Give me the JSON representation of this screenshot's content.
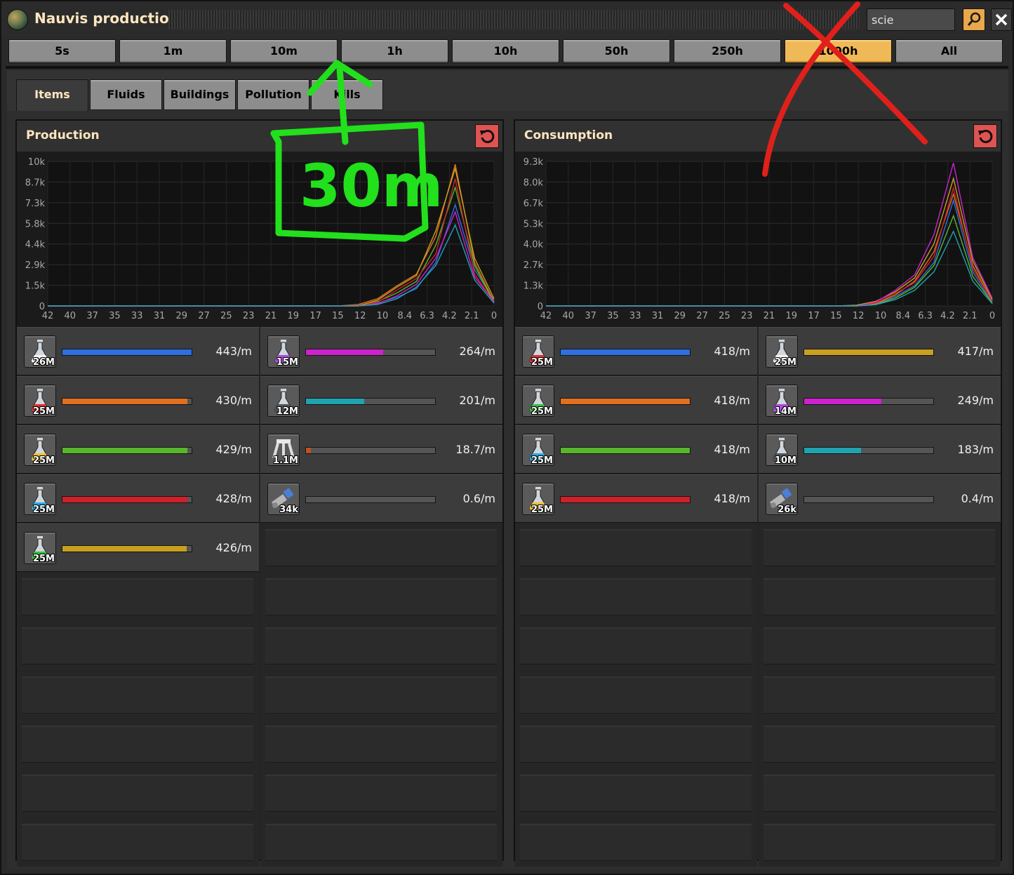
{
  "window": {
    "title": "Nauvis production"
  },
  "search": {
    "value": "scie"
  },
  "time_ranges": [
    {
      "label": "5s",
      "active": false
    },
    {
      "label": "1m",
      "active": false
    },
    {
      "label": "10m",
      "active": false
    },
    {
      "label": "1h",
      "active": false
    },
    {
      "label": "10h",
      "active": false
    },
    {
      "label": "50h",
      "active": false
    },
    {
      "label": "250h",
      "active": false
    },
    {
      "label": "1000h",
      "active": true
    },
    {
      "label": "All",
      "active": false
    }
  ],
  "tabs": [
    {
      "label": "Items",
      "active": true
    },
    {
      "label": "Fluids",
      "active": false
    },
    {
      "label": "Buildings",
      "active": false
    },
    {
      "label": "Pollution",
      "active": false
    },
    {
      "label": "Kills",
      "active": false
    }
  ],
  "colors": {
    "accent": "#f0b957",
    "reset": "#e05353",
    "annotation_green": "#22e01b",
    "annotation_red": "#e0201b"
  },
  "annotations": {
    "handwritten_text": "30m"
  },
  "production": {
    "title": "Production",
    "chart_data": {
      "type": "line",
      "ylabel_ticks": [
        "10k",
        "8.7k",
        "7.3k",
        "5.8k",
        "4.4k",
        "2.9k",
        "1.5k",
        "0"
      ],
      "x_ticks": [
        "42",
        "40",
        "37",
        "35",
        "33",
        "31",
        "29",
        "27",
        "25",
        "23",
        "21",
        "19",
        "17",
        "15",
        "12",
        "10",
        "8.4",
        "6.3",
        "4.2",
        "2.1",
        "0"
      ],
      "ylim": [
        0,
        10000
      ],
      "grid": true,
      "series": [
        {
          "color": "#2f6fe0",
          "values": [
            0,
            0,
            0,
            0,
            0,
            0,
            0,
            0,
            0,
            0,
            0,
            0,
            0,
            0,
            0,
            0,
            0,
            200,
            600,
            1200,
            3000,
            7000,
            2500,
            400
          ]
        },
        {
          "color": "#e07020",
          "values": [
            0,
            0,
            0,
            0,
            0,
            0,
            0,
            0,
            0,
            0,
            0,
            0,
            0,
            0,
            0,
            0,
            100,
            500,
            1400,
            2200,
            4800,
            9800,
            3000,
            300
          ]
        },
        {
          "color": "#58b62c",
          "values": [
            0,
            0,
            0,
            0,
            0,
            0,
            0,
            0,
            0,
            0,
            0,
            0,
            0,
            0,
            0,
            0,
            0,
            300,
            900,
            1700,
            4200,
            8200,
            2800,
            200
          ]
        },
        {
          "color": "#d0202a",
          "values": [
            0,
            0,
            0,
            0,
            0,
            0,
            0,
            0,
            0,
            0,
            0,
            0,
            0,
            0,
            0,
            0,
            50,
            250,
            1100,
            1900,
            3600,
            8800,
            2200,
            250
          ]
        },
        {
          "color": "#c8a020",
          "values": [
            0,
            0,
            0,
            0,
            0,
            0,
            0,
            0,
            0,
            0,
            0,
            0,
            0,
            0,
            0,
            0,
            0,
            400,
            1300,
            2100,
            5200,
            9500,
            3300,
            500
          ]
        },
        {
          "color": "#cc22cc",
          "values": [
            0,
            0,
            0,
            0,
            0,
            0,
            0,
            0,
            0,
            0,
            0,
            0,
            0,
            0,
            0,
            0,
            0,
            150,
            700,
            1500,
            3300,
            6500,
            2000,
            300
          ]
        },
        {
          "color": "#1fa3b0",
          "values": [
            0,
            0,
            0,
            0,
            0,
            0,
            0,
            0,
            0,
            0,
            0,
            0,
            0,
            0,
            0,
            0,
            0,
            100,
            500,
            1300,
            2800,
            5600,
            1800,
            200
          ]
        }
      ]
    },
    "rows": [
      {
        "icon": "white-science-pack-icon",
        "flask": "#f4f4f4",
        "count": "26M",
        "bar_color": "#2f6fe0",
        "fill": 1.0,
        "rate": "443/m"
      },
      {
        "icon": "purple-science-pack-icon",
        "flask": "#b04ae0",
        "count": "15M",
        "bar_color": "#cc22cc",
        "fill": 0.6,
        "rate": "264/m"
      },
      {
        "icon": "red-science-pack-icon",
        "flask": "#e03030",
        "count": "25M",
        "bar_color": "#e07020",
        "fill": 0.97,
        "rate": "430/m"
      },
      {
        "icon": "black-science-pack-icon",
        "flask": "#555555",
        "count": "12M",
        "bar_color": "#1fa3b0",
        "fill": 0.45,
        "rate": "201/m"
      },
      {
        "icon": "yellow-science-pack-icon",
        "flask": "#f0c030",
        "count": "25M",
        "bar_color": "#58b62c",
        "fill": 0.97,
        "rate": "429/m"
      },
      {
        "icon": "lab-icon",
        "flask": "#bbbbbb",
        "count": "1.1M",
        "bar_color": "#c05020",
        "fill": 0.04,
        "rate": "18.7/m"
      },
      {
        "icon": "blue-science-pack-icon",
        "flask": "#2aa8e0",
        "count": "25M",
        "bar_color": "#d0202a",
        "fill": 0.97,
        "rate": "428/m"
      },
      {
        "icon": "satellite-icon",
        "flask": "#9aa0a8",
        "count": "34k",
        "bar_color": "#666666",
        "fill": 0.0,
        "rate": "0.6/m"
      },
      {
        "icon": "green-science-pack-icon",
        "flask": "#38c040",
        "count": "25M",
        "bar_color": "#c8a020",
        "fill": 0.96,
        "rate": "426/m"
      }
    ]
  },
  "consumption": {
    "title": "Consumption",
    "chart_data": {
      "type": "line",
      "ylabel_ticks": [
        "9.3k",
        "8.0k",
        "6.7k",
        "5.3k",
        "4.0k",
        "2.7k",
        "1.3k",
        "0"
      ],
      "x_ticks": [
        "42",
        "40",
        "37",
        "35",
        "33",
        "31",
        "29",
        "27",
        "25",
        "23",
        "21",
        "19",
        "17",
        "15",
        "12",
        "10",
        "8.4",
        "6.3",
        "4.2",
        "2.1",
        "0"
      ],
      "ylim": [
        0,
        9300
      ],
      "grid": true,
      "series": [
        {
          "color": "#2f6fe0",
          "values": [
            0,
            0,
            0,
            0,
            0,
            0,
            0,
            0,
            0,
            0,
            0,
            0,
            0,
            0,
            0,
            0,
            0,
            100,
            600,
            1300,
            2800,
            6800,
            2200,
            200
          ]
        },
        {
          "color": "#e07020",
          "values": [
            0,
            0,
            0,
            0,
            0,
            0,
            0,
            0,
            0,
            0,
            0,
            0,
            0,
            0,
            0,
            0,
            0,
            150,
            700,
            1600,
            3500,
            7200,
            2600,
            300
          ]
        },
        {
          "color": "#58b62c",
          "values": [
            0,
            0,
            0,
            0,
            0,
            0,
            0,
            0,
            0,
            0,
            0,
            0,
            0,
            0,
            0,
            0,
            0,
            100,
            500,
            1200,
            2600,
            5800,
            1900,
            200
          ]
        },
        {
          "color": "#d0202a",
          "values": [
            0,
            0,
            0,
            0,
            0,
            0,
            0,
            0,
            0,
            0,
            0,
            0,
            0,
            0,
            0,
            0,
            0,
            200,
            800,
            1500,
            3200,
            7600,
            2400,
            300
          ]
        },
        {
          "color": "#c8a020",
          "values": [
            0,
            0,
            0,
            0,
            0,
            0,
            0,
            0,
            0,
            0,
            0,
            0,
            0,
            0,
            0,
            0,
            50,
            300,
            900,
            1800,
            4000,
            8200,
            2900,
            400
          ]
        },
        {
          "color": "#cc22cc",
          "values": [
            0,
            0,
            0,
            0,
            0,
            0,
            0,
            0,
            0,
            0,
            0,
            0,
            0,
            0,
            0,
            0,
            0,
            250,
            1000,
            2000,
            4600,
            9200,
            3100,
            500
          ]
        },
        {
          "color": "#1fa3b0",
          "values": [
            0,
            0,
            0,
            0,
            0,
            0,
            0,
            0,
            0,
            0,
            0,
            0,
            0,
            0,
            0,
            0,
            0,
            80,
            400,
            1000,
            2200,
            4800,
            1600,
            150
          ]
        }
      ]
    },
    "rows": [
      {
        "icon": "red-science-pack-icon",
        "flask": "#e03030",
        "count": "25M",
        "bar_color": "#2f6fe0",
        "fill": 1.0,
        "rate": "418/m"
      },
      {
        "icon": "white-science-pack-icon",
        "flask": "#f4f4f4",
        "count": "25M",
        "bar_color": "#c8a020",
        "fill": 1.0,
        "rate": "417/m"
      },
      {
        "icon": "green-science-pack-icon",
        "flask": "#38c040",
        "count": "25M",
        "bar_color": "#e07020",
        "fill": 1.0,
        "rate": "418/m"
      },
      {
        "icon": "purple-science-pack-icon",
        "flask": "#b04ae0",
        "count": "14M",
        "bar_color": "#cc22cc",
        "fill": 0.6,
        "rate": "249/m"
      },
      {
        "icon": "blue-science-pack-icon",
        "flask": "#2aa8e0",
        "count": "25M",
        "bar_color": "#58b62c",
        "fill": 1.0,
        "rate": "418/m"
      },
      {
        "icon": "black-science-pack-icon",
        "flask": "#555555",
        "count": "10M",
        "bar_color": "#1fa3b0",
        "fill": 0.44,
        "rate": "183/m"
      },
      {
        "icon": "yellow-science-pack-icon",
        "flask": "#f0c030",
        "count": "25M",
        "bar_color": "#d0202a",
        "fill": 1.0,
        "rate": "418/m"
      },
      {
        "icon": "satellite-icon",
        "flask": "#9aa0a8",
        "count": "26k",
        "bar_color": "#666666",
        "fill": 0.0,
        "rate": "0.4/m"
      }
    ]
  }
}
